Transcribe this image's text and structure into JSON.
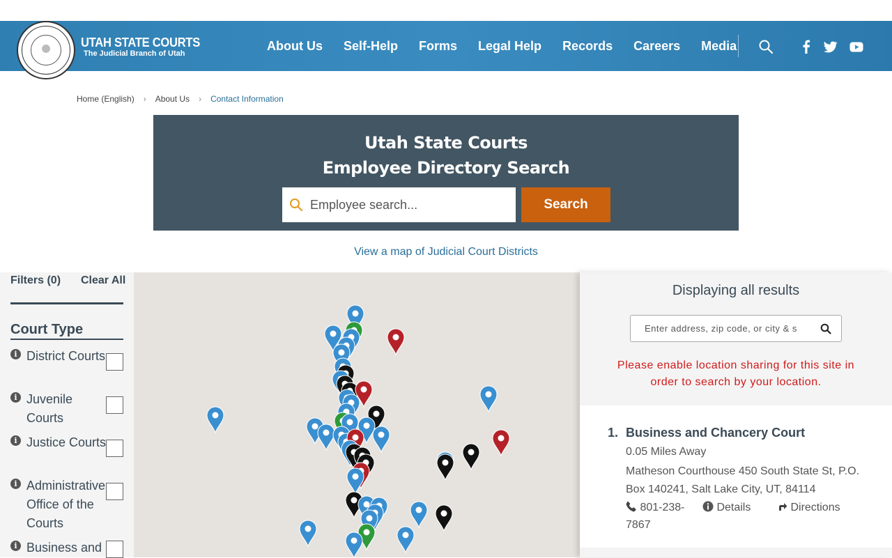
{
  "header": {
    "brand_title": "UTAH STATE COURTS",
    "brand_subtitle": "The Judicial Branch of Utah",
    "nav": [
      "About Us",
      "Self-Help",
      "Forms",
      "Legal Help",
      "Records",
      "Careers",
      "Media"
    ],
    "icons": [
      "search-icon",
      "facebook-icon",
      "twitter-icon",
      "youtube-icon"
    ]
  },
  "breadcrumb": [
    "Home (English)",
    "About Us",
    "Contact Information"
  ],
  "directory": {
    "title_line1": "Utah State Courts",
    "title_line2": "Employee Directory Search",
    "search_placeholder": "Employee search...",
    "search_button": "Search"
  },
  "map_link": "View a map of Judicial Court Districts",
  "filters": {
    "heading": "Filters (0)",
    "clear": "Clear All",
    "group": "Court Type",
    "items": [
      {
        "label": "District Courts",
        "checked": false
      },
      {
        "label": "Juvenile Courts",
        "checked": false
      },
      {
        "label": "Justice Courts",
        "checked": false
      },
      {
        "label": "Administrative Office of the Courts",
        "checked": false
      },
      {
        "label": "Business and",
        "checked": false
      }
    ]
  },
  "results": {
    "title": "Displaying all results",
    "address_placeholder": "Enter address, zip code, or city & s",
    "warning": "Please enable location sharing for this site in order to search by your location.",
    "items": [
      {
        "number": "1.",
        "name": "Business and Chancery Court",
        "distance": "0.05 Miles Away",
        "address": "Matheson Courthouse 450 South State St, P.O. Box 140241, Salt Lake City, UT, 84114",
        "phone": "801-238-7867",
        "details": "Details",
        "directions": "Directions"
      }
    ]
  },
  "colors": {
    "header": "#3a8cc0",
    "panel": "#435663",
    "button": "#c9610f",
    "link": "#2a6e99",
    "warning": "#d11a1a",
    "marker_blue": "#3a8fd0",
    "marker_red": "#b52128",
    "marker_black": "#111111",
    "marker_green": "#2e9a3a"
  }
}
